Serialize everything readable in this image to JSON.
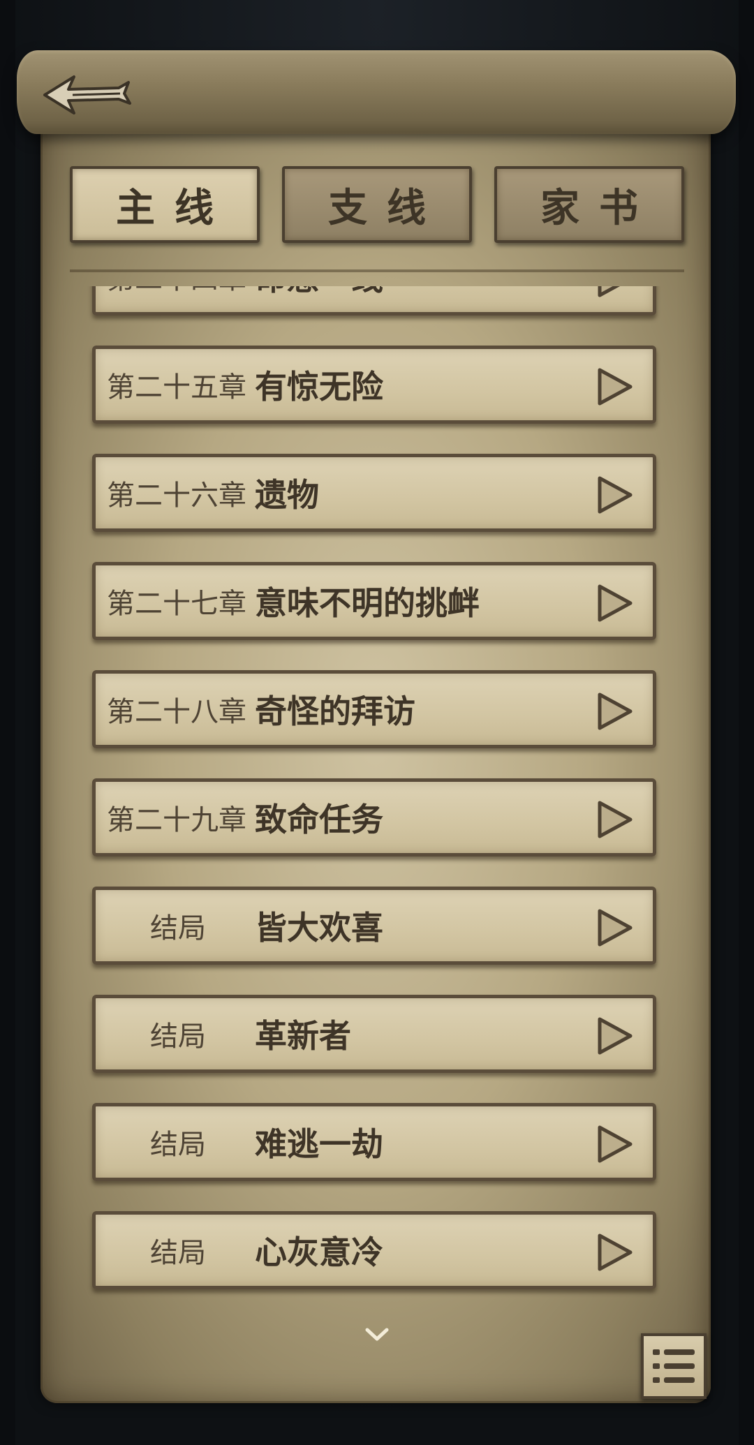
{
  "tabs": [
    {
      "label": "主线",
      "active": true
    },
    {
      "label": "支线",
      "active": false
    },
    {
      "label": "家书",
      "active": false
    }
  ],
  "chapters": [
    {
      "number": "第二十四章",
      "title": "命悬一线"
    },
    {
      "number": "第二十五章",
      "title": "有惊无险"
    },
    {
      "number": "第二十六章",
      "title": "遗物"
    },
    {
      "number": "第二十七章",
      "title": "意味不明的挑衅"
    },
    {
      "number": "第二十八章",
      "title": "奇怪的拜访"
    },
    {
      "number": "第二十九章",
      "title": "致命任务"
    },
    {
      "number": "结局",
      "title": "皆大欢喜"
    },
    {
      "number": "结局",
      "title": "革新者"
    },
    {
      "number": "结局",
      "title": "难逃一劫"
    },
    {
      "number": "结局",
      "title": "心灰意冷"
    }
  ],
  "icons": {
    "back": "back-arrow-icon",
    "play": "play-triangle-icon",
    "scroll_down": "chevron-down-icon",
    "menu": "list-menu-icon"
  },
  "colors": {
    "parchment": "#cfc3a2",
    "row_fill": "#ddd2b4",
    "border_dark": "#5a4c3a",
    "text_dark": "#3e3427"
  }
}
